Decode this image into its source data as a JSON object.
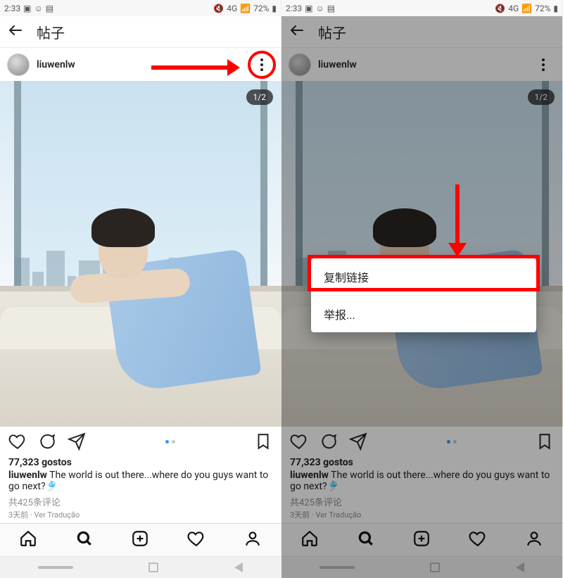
{
  "status": {
    "time": "2:33",
    "network_label": "4G",
    "battery_text": "72%"
  },
  "header": {
    "title": "帖子"
  },
  "post": {
    "username": "liuwenlw",
    "counter": "1/2",
    "likes": "77,323 gostos",
    "caption_user": "liuwenlw",
    "caption_text": " The world is out there...where do you guys want to go next?🎐",
    "comments": "共425条评论",
    "time_line": "3天前 · Ver Tradução"
  },
  "menu": {
    "copy_link": "复制链接",
    "report": "举报..."
  }
}
